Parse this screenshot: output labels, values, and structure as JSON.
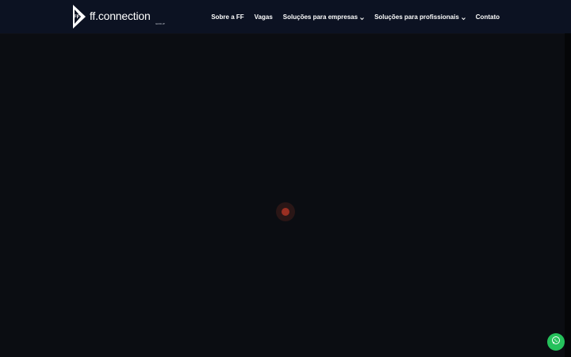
{
  "logo": {
    "name": "ff.connection",
    "sub": "GROUP",
    "mark_letters": "FF"
  },
  "nav": {
    "items": [
      {
        "label": "Sobre a FF",
        "has_dropdown": false
      },
      {
        "label": "Vagas",
        "has_dropdown": false
      },
      {
        "label": "Soluções para empresas",
        "has_dropdown": true
      },
      {
        "label": "Soluções para profissionais",
        "has_dropdown": true
      },
      {
        "label": "Contato",
        "has_dropdown": false
      }
    ]
  },
  "icons": {
    "dropdown": "chevron-down-icon",
    "whatsapp": "whatsapp-icon",
    "loader": "loading-spinner-icon"
  },
  "colors": {
    "header_bg": "#0c1222",
    "page_bg": "#0b0d12",
    "loader": "#9a2f22",
    "whatsapp": "#25c15b"
  }
}
